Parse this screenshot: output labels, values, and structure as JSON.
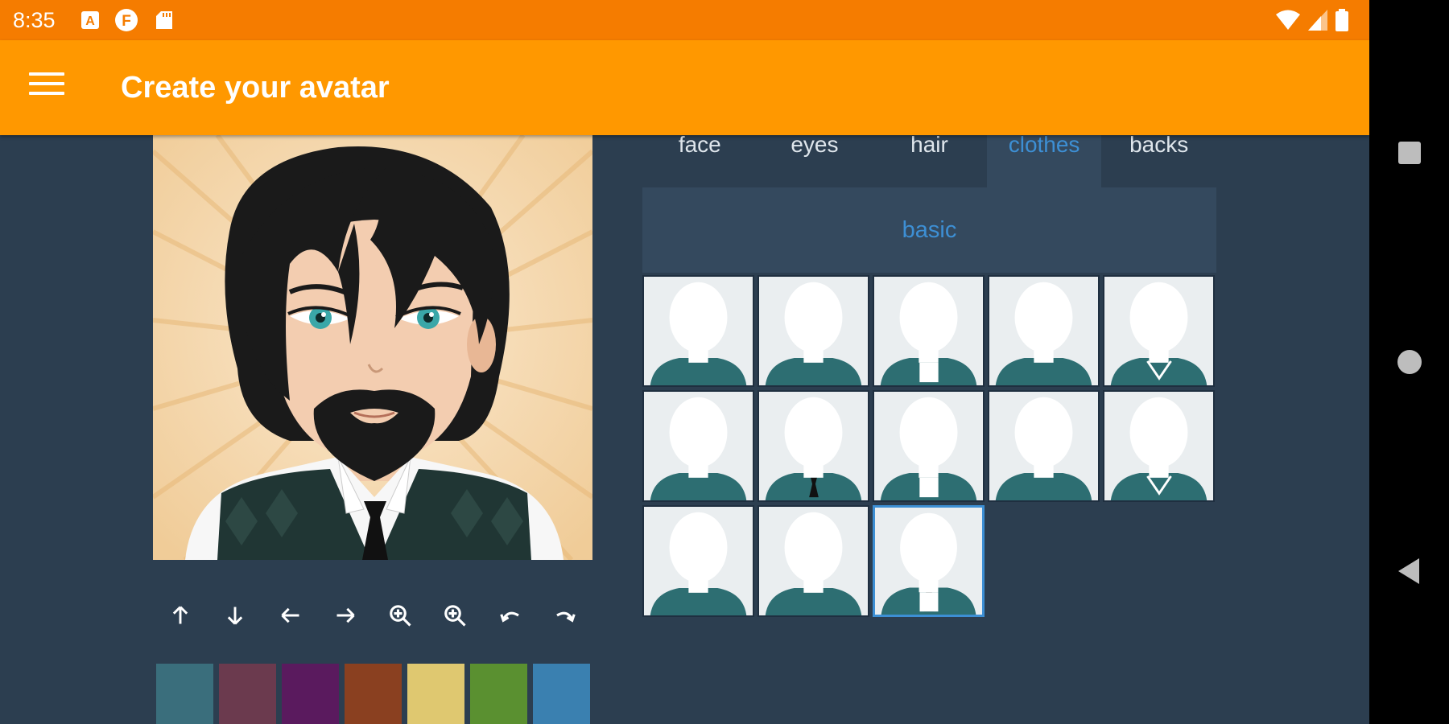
{
  "status_bar": {
    "time": "8:35",
    "left_icons": [
      "a-square-icon",
      "f-circle-icon",
      "sd-card-icon"
    ],
    "right_icons": [
      "wifi-icon",
      "signal-icon",
      "battery-icon"
    ]
  },
  "app_bar": {
    "title": "Create your avatar",
    "menu_icon": "hamburger-menu-icon"
  },
  "tabs": [
    {
      "label": "face",
      "active": false
    },
    {
      "label": "eyes",
      "active": false
    },
    {
      "label": "hair",
      "active": false
    },
    {
      "label": "clothes",
      "active": true
    },
    {
      "label": "backs",
      "active": false
    }
  ],
  "subcategory": {
    "label": "basic"
  },
  "controls": [
    {
      "icon": "arrow-up-icon"
    },
    {
      "icon": "arrow-down-icon"
    },
    {
      "icon": "arrow-left-icon"
    },
    {
      "icon": "arrow-right-icon"
    },
    {
      "icon": "zoom-in-icon"
    },
    {
      "icon": "zoom-out-icon"
    },
    {
      "icon": "undo-icon"
    },
    {
      "icon": "redo-icon"
    }
  ],
  "swatches": [
    "#3a6e7c",
    "#6b3a4e",
    "#5a1a5e",
    "#8a4020",
    "#dfc870",
    "#5a9030",
    "#3a80b0"
  ],
  "clothes_grid": {
    "count": 13,
    "selected_index": 12,
    "clothing_color": "#2d6e72"
  },
  "colors": {
    "status_bar": "#f57c00",
    "app_bar": "#ff9800",
    "background": "#2c3e50",
    "panel": "#34495e",
    "accent": "#3d8fd4"
  },
  "nav_bar": {
    "buttons": [
      "recents-square-icon",
      "home-circle-icon",
      "back-triangle-icon"
    ]
  }
}
